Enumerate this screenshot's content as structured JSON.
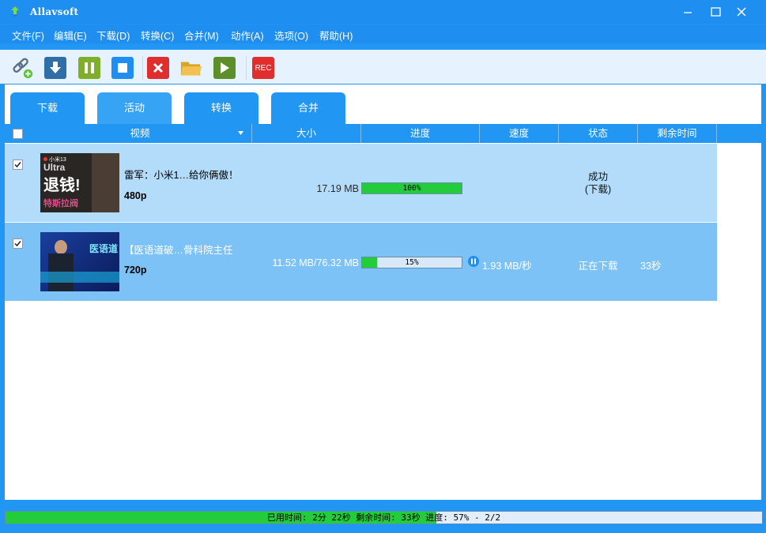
{
  "window": {
    "title": "Allavsoft"
  },
  "menu": [
    "文件(F)",
    "编辑(E)",
    "下载(D)",
    "转换(C)",
    "合并(M)",
    "动作(A)",
    "选项(O)",
    "帮助(H)"
  ],
  "toolbar": {
    "rec_label": "REC"
  },
  "tabs": [
    "下载",
    "活动",
    "转换",
    "合并"
  ],
  "columns": {
    "video": "视频",
    "size": "大小",
    "progress": "进度",
    "speed": "速度",
    "status": "状态",
    "remaining": "剩余时间"
  },
  "rows": [
    {
      "title": "雷军：小米1…给你俩傲！",
      "resolution": "480p",
      "size": "17.19 MB",
      "progress_text": "100%",
      "progress_percent": 100,
      "speed": "",
      "status_line1": "成功",
      "status_line2": "(下载)",
      "remaining": "",
      "thumb": {
        "line1": "小米13",
        "line2": "Ultra",
        "line3": "退钱!",
        "line4": "特斯拉阀"
      }
    },
    {
      "title": "【医语道破…骨科院主任",
      "resolution": "720p",
      "size": "11.52 MB/76.32 MB",
      "progress_text": "15%",
      "progress_percent": 15,
      "speed": "1.93 MB/秒",
      "status_line1": "正在下载",
      "remaining": "33秒",
      "thumb": {
        "line1": "医语道"
      }
    }
  ],
  "statusbar": {
    "text": "已用时间: 2分 22秒 剩余时间: 33秒 进度: 57% - 2/2",
    "progress_percent": 57
  },
  "colors": {
    "accent": "#2196f3",
    "progress": "#22cc3a",
    "row_done": "#b3dcfb",
    "row_active": "#7dc2f7"
  }
}
